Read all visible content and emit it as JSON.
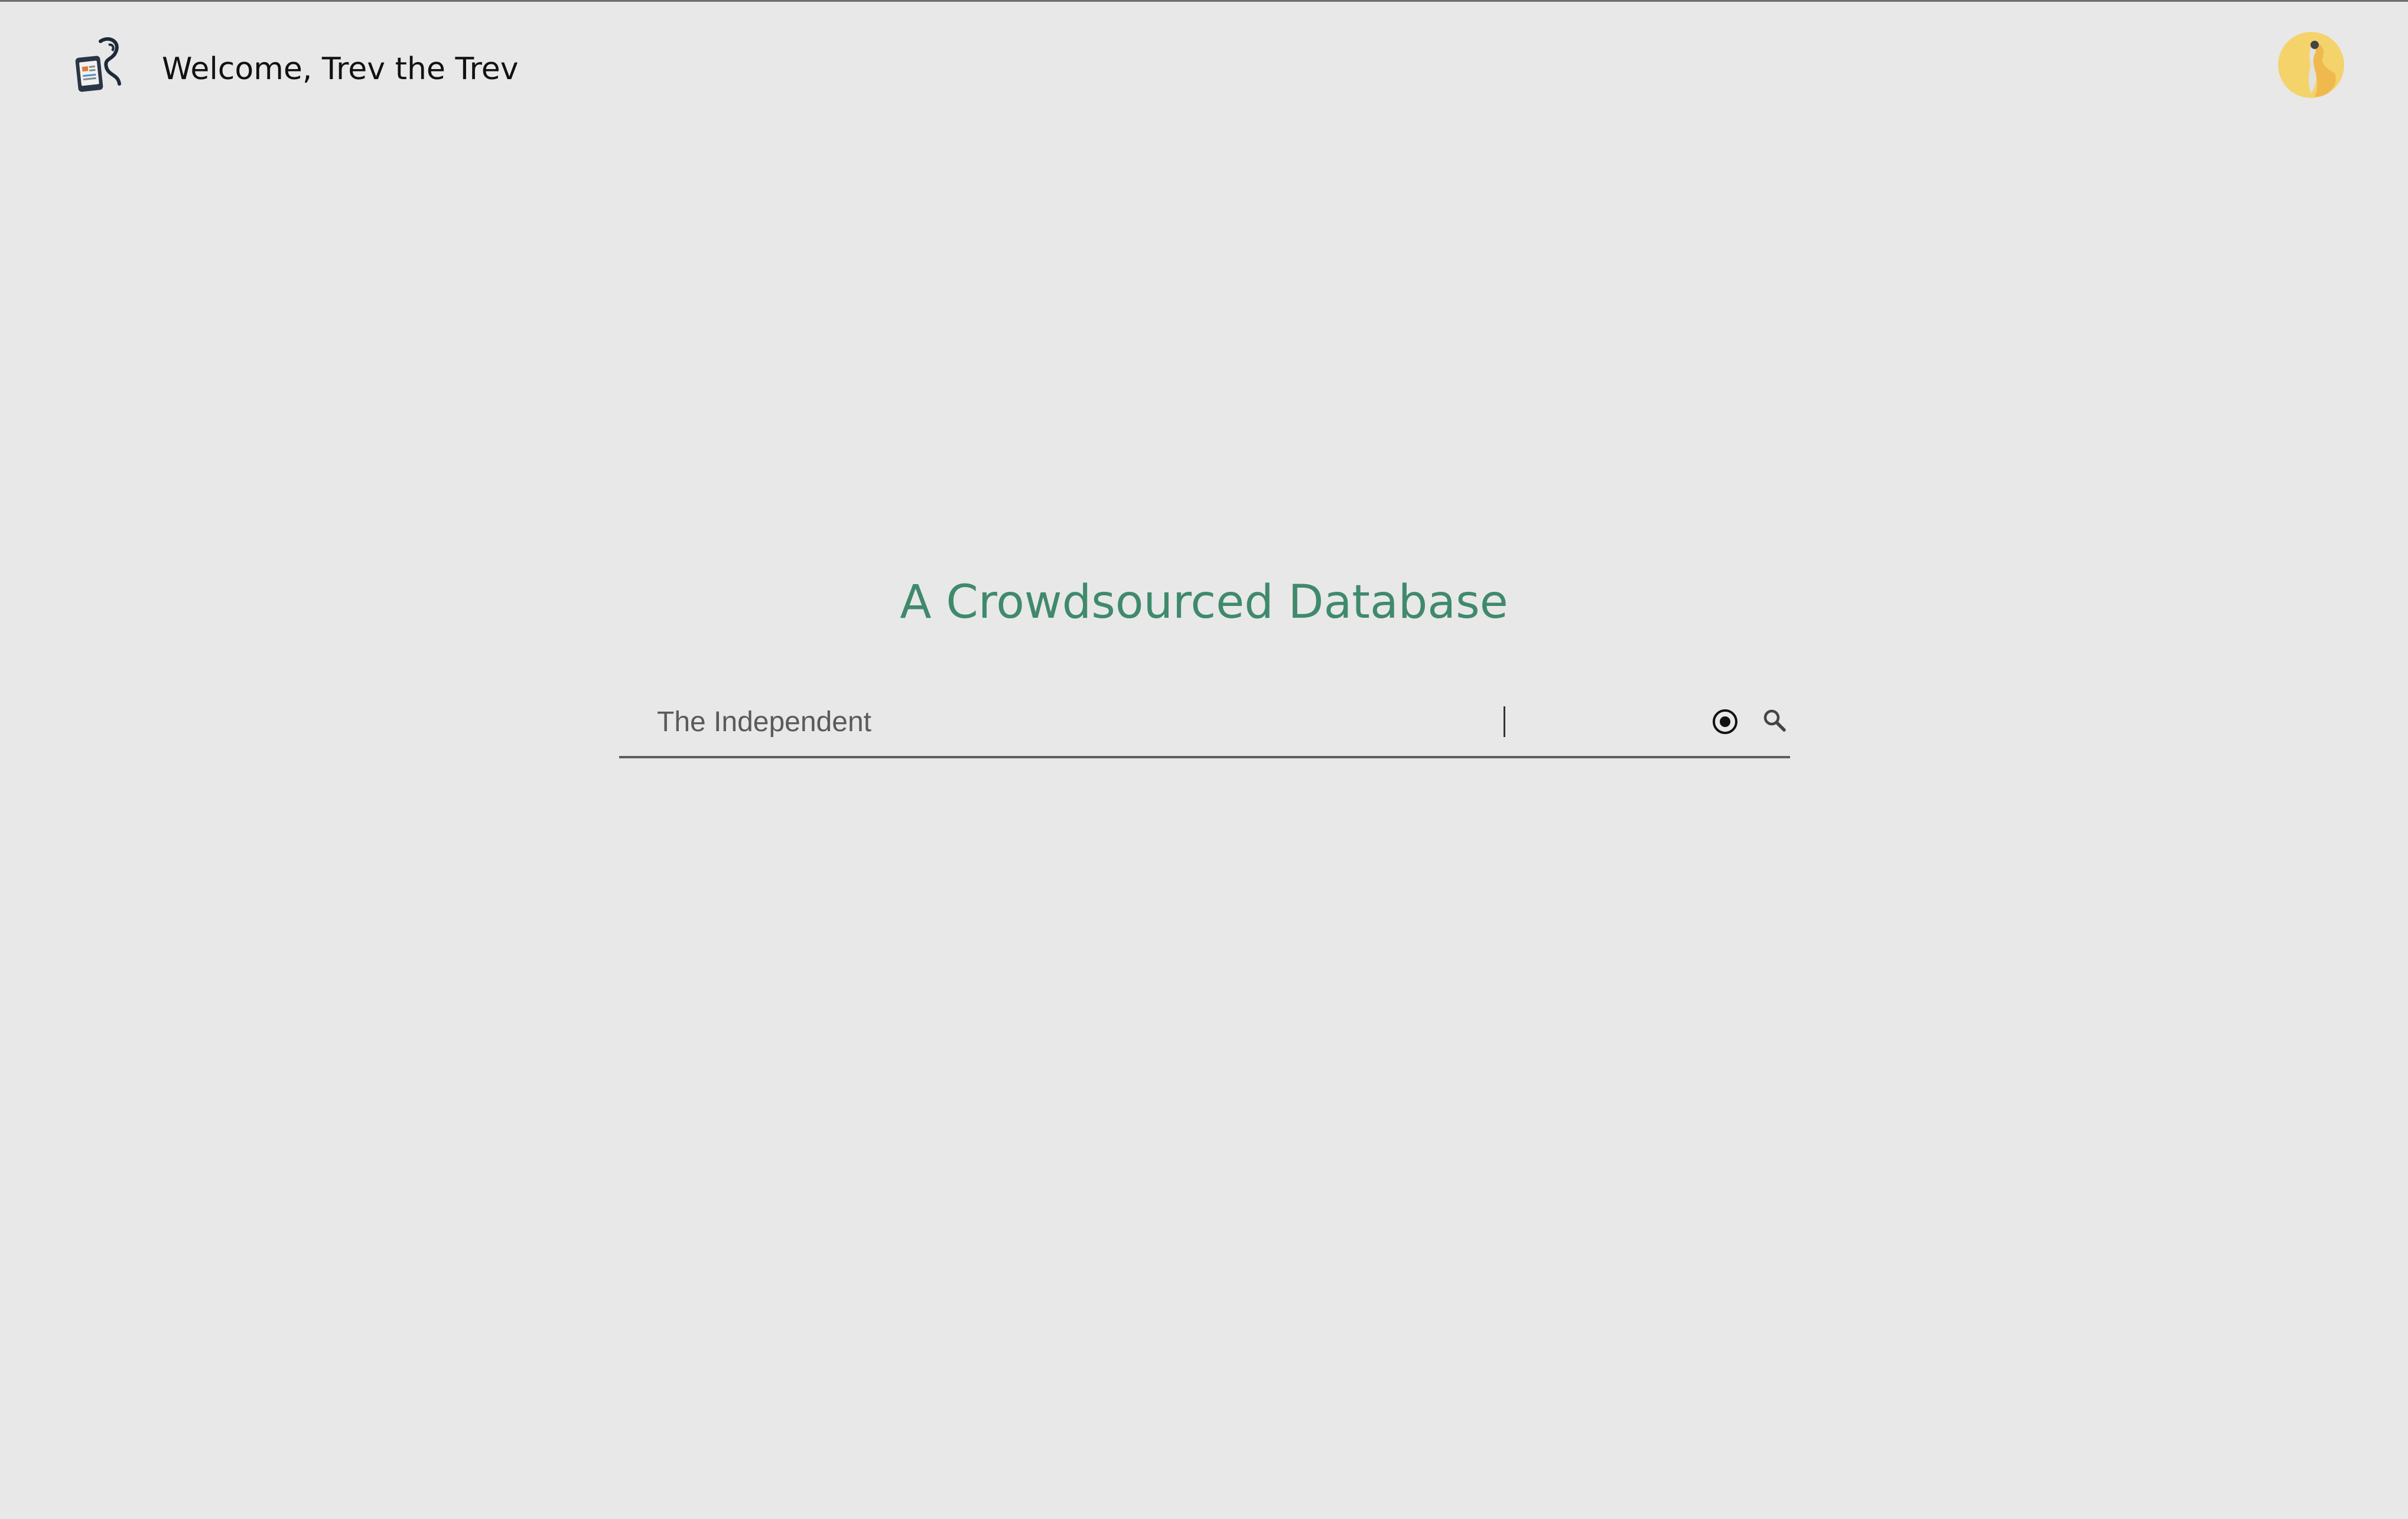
{
  "header": {
    "logo_icon": "badge-lanyard-icon",
    "welcome_text": "Welcome, Trev the Trev",
    "avatar_icon": "user-avatar-icon"
  },
  "main": {
    "tagline": "A Crowdsourced Database",
    "search": {
      "value": "The Independent",
      "placeholder": "",
      "radio_icon": "radio-target-icon",
      "search_icon": "search-icon"
    }
  },
  "colors": {
    "background": "#e8e8e8",
    "tagline": "#3f8a6c",
    "underline": "#5e5e5e",
    "avatar_bg": "#f4d36b"
  }
}
